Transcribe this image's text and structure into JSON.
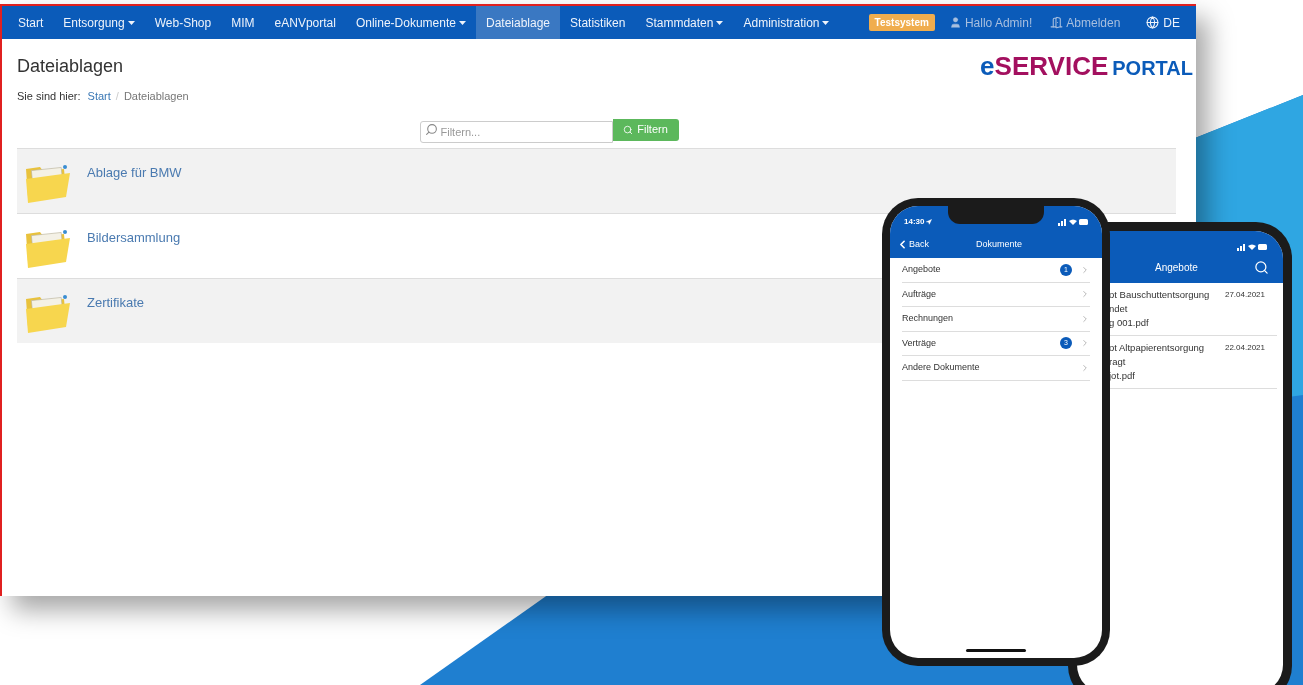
{
  "nav": {
    "items": [
      {
        "label": "Start",
        "dropdown": false,
        "selected": false
      },
      {
        "label": "Entsorgung",
        "dropdown": true,
        "selected": false
      },
      {
        "label": "Web-Shop",
        "dropdown": false,
        "selected": false
      },
      {
        "label": "MIM",
        "dropdown": false,
        "selected": false
      },
      {
        "label": "eANVportal",
        "dropdown": false,
        "selected": false
      },
      {
        "label": "Online-Dokumente",
        "dropdown": true,
        "selected": false
      },
      {
        "label": "Dateiablage",
        "dropdown": false,
        "selected": true
      },
      {
        "label": "Statistiken",
        "dropdown": false,
        "selected": false
      },
      {
        "label": "Stammdaten",
        "dropdown": true,
        "selected": false
      },
      {
        "label": "Administration",
        "dropdown": true,
        "selected": false
      }
    ],
    "badge": "Testsystem",
    "user": "Hallo Admin!",
    "logout": "Abmelden",
    "language": "DE"
  },
  "logo": {
    "prefix": "e",
    "main": "SERVICE",
    "suffix": "PORTAL"
  },
  "page": {
    "title": "Dateiablagen",
    "breadcrumb_label": "Sie sind hier:",
    "separator": "/",
    "breadcrumb": [
      {
        "label": "Start",
        "link": true
      },
      {
        "label": "Dateiablagen",
        "link": false
      }
    ]
  },
  "filter": {
    "placeholder": "Filtern...",
    "button": "Filtern"
  },
  "folders": [
    {
      "name": "Ablage für BMW"
    },
    {
      "name": "Bildersammlung"
    },
    {
      "name": "Zertifikate"
    }
  ],
  "phone_1": {
    "time": "14:30",
    "back": "Back",
    "title": "Dokumente",
    "items": [
      {
        "label": "Angebote",
        "count": "1"
      },
      {
        "label": "Aufträge"
      },
      {
        "label": "Rechnungen"
      },
      {
        "label": "Verträge",
        "count": "3"
      },
      {
        "label": "Andere Dokumente"
      }
    ]
  },
  "phone_2": {
    "title": "Angebote",
    "items": [
      {
        "lines": [
          "ot Bauschuttentsorgung",
          "ndet",
          "g 001.pdf"
        ],
        "date": "27.04.2021"
      },
      {
        "lines": [
          "ot Altpapierentsorgung",
          "ragt",
          "jot.pdf"
        ],
        "date": "22.04.2021"
      }
    ]
  }
}
